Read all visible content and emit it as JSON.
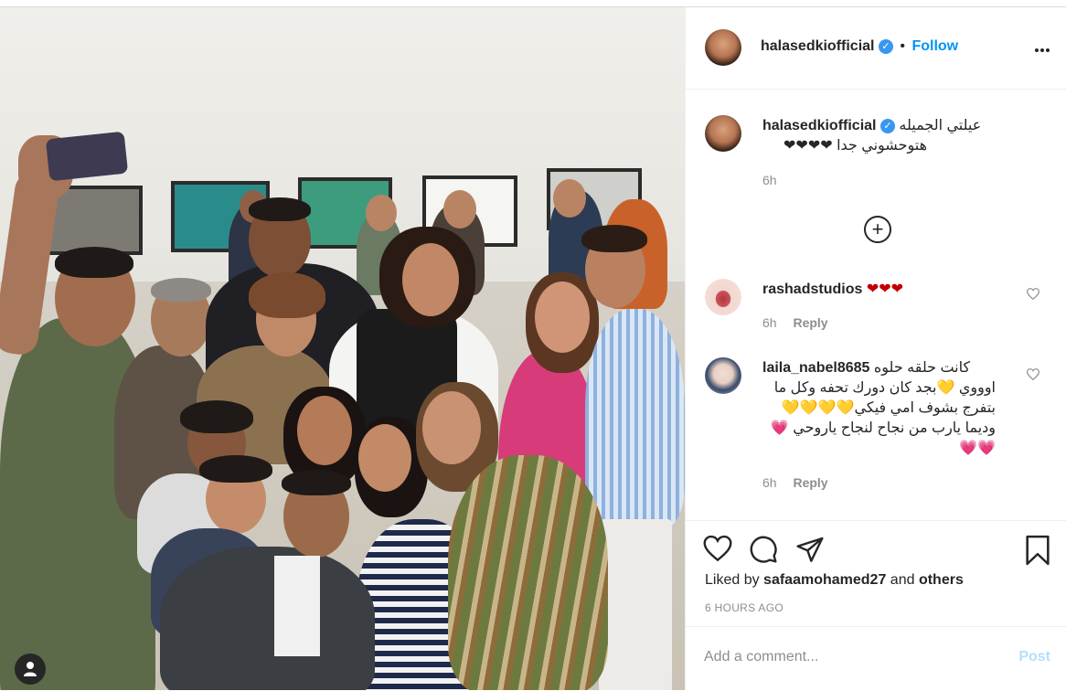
{
  "post": {
    "author": "halasedkiofficial",
    "follow_label": "Follow",
    "separator": "•",
    "more_label": "•••",
    "verified_symbol": "✓"
  },
  "caption": {
    "author": "halasedkiofficial",
    "line1": "عيلتي الجميله",
    "line2": "هتوحشوني جدا ❤❤❤❤",
    "time": "6h"
  },
  "load_more_symbol": "+",
  "comments": [
    {
      "author": "rashadstudios",
      "text": "❤❤❤",
      "time": "6h",
      "reply": "Reply"
    },
    {
      "author": "laila_nabel8685",
      "line1": "كانت حلقه حلوه",
      "line2": "اوووي 💛بجد كان دورك تحفه وكل ما",
      "line3": "بتفرج بشوف امي فيكي💛💛💛💛",
      "line4": "وديما يارب من نجاح لنجاح ياروحي 💗",
      "line5": "💗💗",
      "time": "6h",
      "reply": "Reply"
    }
  ],
  "liked_by": {
    "prefix": "Liked by",
    "user": "safaamohamed27",
    "and": "and",
    "others": "others"
  },
  "timestamp": "6 HOURS AGO",
  "add_comment": {
    "placeholder": "Add a comment...",
    "post_label": "Post"
  },
  "icons": {
    "like": "heart-icon",
    "comment": "comment-icon",
    "share": "send-icon",
    "save": "bookmark-icon",
    "user_tag": "user-tag-icon"
  },
  "colors": {
    "accent": "#0095f6",
    "verified": "#3897f0",
    "heart": "#c00000",
    "muted": "#8e8e8e",
    "post_disabled": "#b2dffc"
  }
}
